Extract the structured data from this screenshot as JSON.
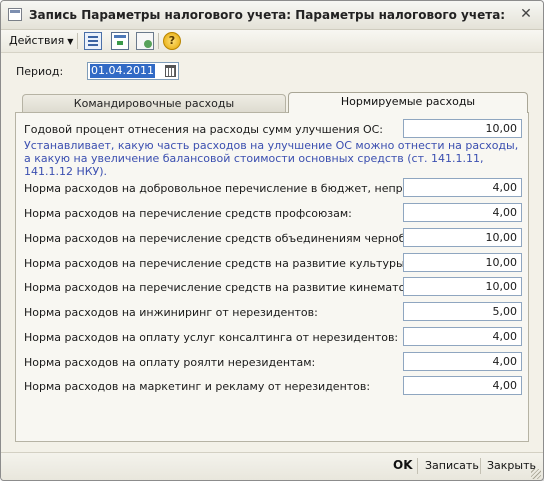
{
  "window": {
    "title": "Запись Параметры налогового учета: Параметры налогового учета:"
  },
  "toolbar": {
    "actions_label": "Действия",
    "icons": [
      "list-icon",
      "pane-icon",
      "copy-icon",
      "help-icon"
    ],
    "help_glyph": "?"
  },
  "period": {
    "label": "Период:",
    "value": "01.04.2011"
  },
  "tabs": [
    {
      "label": "Командировочные расходы",
      "active": false
    },
    {
      "label": "Нормируемые расходы",
      "active": true
    }
  ],
  "annual": {
    "label": "Годовой процент отнесения на расходы сумм улучшения ОС:",
    "value": "10,00",
    "hint": "Устанавливает, какую часть расходов на улучшение ОС можно отнести на расходы, а какую на увеличение балансовой стоимости основных средств (ст. 141.1.11, 141.1.12 НКУ)."
  },
  "norms": [
    {
      "label": "Норма расходов на добровольное перечисление в бюджет, неприбыль...",
      "value": "4,00"
    },
    {
      "label": "Норма расходов на перечисление средств профсоюзам:",
      "value": "4,00"
    },
    {
      "label": "Норма расходов на перечисление средств объединениям чернобыльц...",
      "value": "10,00"
    },
    {
      "label": "Норма расходов на перечисление средств на развитие культуры:",
      "value": "10,00"
    },
    {
      "label": "Норма расходов на перечисление средств на развитие кинематографа:",
      "value": "10,00"
    },
    {
      "label": "Норма расходов на инжиниринг от нерезидентов:",
      "value": "5,00"
    },
    {
      "label": "Норма расходов на оплату услуг консалтинга от нерезидентов:",
      "value": "4,00"
    },
    {
      "label": "Норма расходов на оплату роялти нерезидентам:",
      "value": "4,00"
    },
    {
      "label": "Норма расходов на маркетинг и рекламу от нерезидентов:",
      "value": "4,00"
    }
  ],
  "buttons": {
    "ok": "OK",
    "save": "Записать",
    "close": "Закрыть"
  },
  "colors": {
    "hint_text": "#3b4fb0",
    "selection": "#316ac5"
  }
}
